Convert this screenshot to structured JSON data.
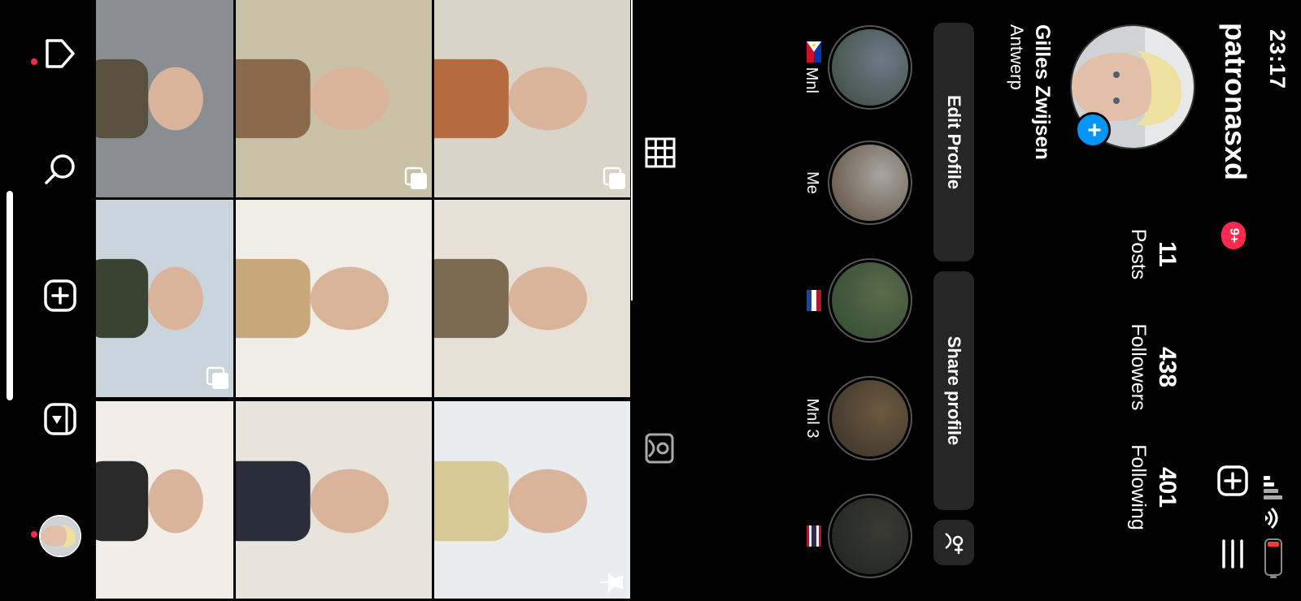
{
  "status": {
    "time": "23:17"
  },
  "header": {
    "username": "patronasxd",
    "notif_count": "9+"
  },
  "profile": {
    "full_name": "Gilles Zwijsen",
    "location": "Antwerp",
    "stats": [
      {
        "value": "11",
        "label": "Posts"
      },
      {
        "value": "438",
        "label": "Followers"
      },
      {
        "value": "401",
        "label": "Following"
      }
    ]
  },
  "buttons": {
    "edit": "Edit Profile",
    "share": "Share profile"
  },
  "highlights": [
    {
      "label": "Mnl",
      "flag": "ph",
      "colors": [
        "#6d7a88",
        "#3b4a3d"
      ]
    },
    {
      "label": "Me",
      "flag": "",
      "colors": [
        "#a8a6a0",
        "#5c4a3a"
      ]
    },
    {
      "label": "",
      "flag": "nl",
      "colors": [
        "#5b6b4a",
        "#2f4a30"
      ]
    },
    {
      "label": "Mnl 3",
      "flag": "",
      "colors": [
        "#6a5a40",
        "#3a3028"
      ]
    },
    {
      "label": "",
      "flag": "th",
      "colors": [
        "#3a3a34",
        "#1e2420"
      ]
    }
  ],
  "grid_posts": [
    {
      "kind": "carousel",
      "colors": [
        "#d9d3c8",
        "#b56a40"
      ]
    },
    {
      "kind": "single",
      "colors": [
        "#e6e0d6",
        "#7a6a50"
      ]
    },
    {
      "kind": "pinned",
      "colors": [
        "#e9edf0",
        "#d8c898"
      ]
    },
    {
      "kind": "carousel",
      "colors": [
        "#c9c0a8",
        "#8a6a4a"
      ]
    },
    {
      "kind": "single",
      "colors": [
        "#f0ece6",
        "#c8a87a"
      ]
    },
    {
      "kind": "single",
      "colors": [
        "#e8e4dc",
        "#2a2e3a"
      ]
    },
    {
      "kind": "single",
      "colors": [
        "#8a8e92",
        "#5a5040"
      ]
    },
    {
      "kind": "carousel",
      "colors": [
        "#c9d4dc",
        "#3a4230"
      ]
    },
    {
      "kind": "single",
      "colors": [
        "#f2ede6",
        "#2a2a2a"
      ]
    }
  ],
  "icons": {
    "add_post": "plus-square-icon",
    "menu": "hamburger-icon",
    "grid_tab": "grid-icon",
    "tagged_tab": "tagged-icon",
    "discover_people": "add-person-icon",
    "nav": [
      "home-icon",
      "search-icon",
      "create-icon",
      "reels-icon",
      "profile-avatar"
    ]
  },
  "colors": {
    "accent_blue": "#0095f6",
    "badge_red": "#ff2a4d",
    "button_bg": "#262626"
  }
}
